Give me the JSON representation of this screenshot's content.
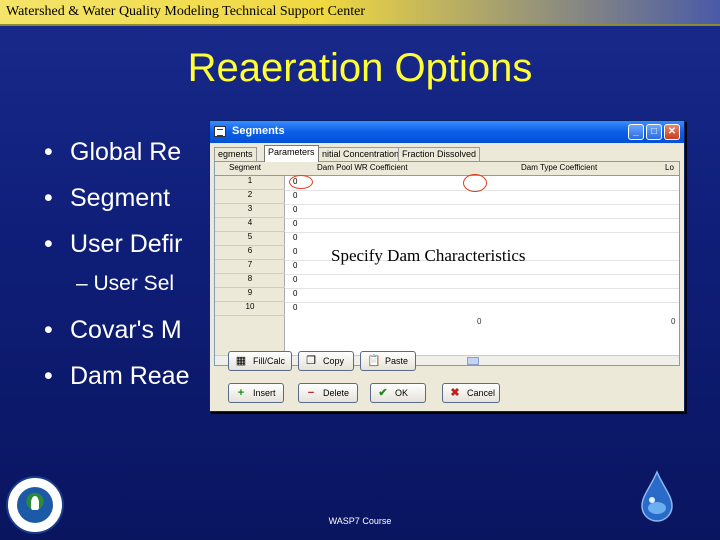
{
  "banner": {
    "title": "Watershed & Water Quality Modeling Technical Support Center"
  },
  "slide": {
    "title": "Reaeration Options",
    "bullets": [
      "Global Re",
      "Segment",
      "User Defir",
      "Covar's M",
      "Dam Reae"
    ],
    "sub_bullet": "– User Sel",
    "bullet_glyph": "•",
    "footer": "WASP7 Course"
  },
  "dialog": {
    "title": "Segments",
    "window_buttons": {
      "minimize": "_",
      "maximize": "□",
      "close": "✕"
    },
    "tabs": [
      "egments",
      "Parameters",
      "nitial Concentrations",
      "Fraction Dissolved"
    ],
    "active_tab": 1,
    "columns": [
      "Segment",
      "Dam Pool WR Coefficient",
      "Dam Type Coefficient",
      "Lo"
    ],
    "rows": [
      {
        "segment": "1",
        "value": "0"
      },
      {
        "segment": "2",
        "value": "0"
      },
      {
        "segment": "3",
        "value": "0"
      },
      {
        "segment": "4",
        "value": "0"
      },
      {
        "segment": "5",
        "value": "0"
      },
      {
        "segment": "6",
        "value": "0"
      },
      {
        "segment": "7",
        "value": "0"
      },
      {
        "segment": "8",
        "value": "0"
      },
      {
        "segment": "9",
        "value": "0"
      },
      {
        "segment": "10",
        "value": "0"
      }
    ],
    "annotation": "Specify Dam Characteristics",
    "tick_glyph": "0",
    "buttons_row1": [
      {
        "label": "Fill/Calc",
        "icon": "calculator-icon"
      },
      {
        "label": "Copy",
        "icon": "copy-icon"
      },
      {
        "label": "Paste",
        "icon": "paste-icon"
      }
    ],
    "buttons_row2": [
      {
        "label": "Insert",
        "icon": "plus-icon"
      },
      {
        "label": "Delete",
        "icon": "minus-icon"
      },
      {
        "label": "OK",
        "icon": "check-icon"
      },
      {
        "label": "Cancel",
        "icon": "x-icon"
      }
    ]
  },
  "colors": {
    "background": "#0f1f7a",
    "title": "#ffff33",
    "banner": "#f0d840",
    "dialog_titlebar": "#0a5fe6",
    "annotation_circle": "#e04020"
  }
}
